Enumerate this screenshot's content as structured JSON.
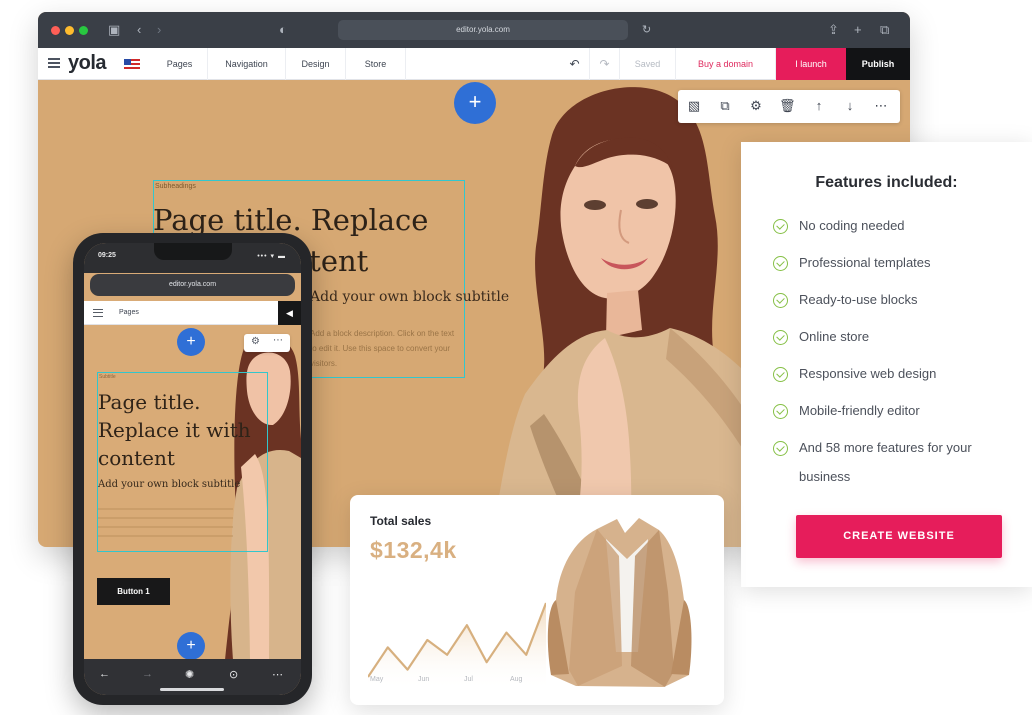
{
  "desktop": {
    "url": "editor.yola.com",
    "logo": "yola",
    "menu": [
      "Pages",
      "Navigation",
      "Design",
      "Store"
    ],
    "saved": "Saved",
    "buy_domain": "Buy a domain",
    "launch": "I launch",
    "publish": "Publish",
    "add_symbol": "+",
    "hero": {
      "kicker": "Subheadings",
      "title": "Page title. Replace it with content",
      "subtitle": "Add your own block subtitle",
      "description": "Add a block description. Click on the text to edit it. Use this space to convert your visitors."
    }
  },
  "features": {
    "title": "Features included:",
    "items": [
      "No coding needed",
      "Professional templates",
      "Ready-to-use blocks",
      "Online store",
      "Responsive web design",
      "Mobile-friendly editor",
      "And 58 more features for your business"
    ],
    "cta": "CREATE WEBSITE"
  },
  "sales": {
    "title": "Total sales",
    "value": "$132,4k",
    "months": [
      "May",
      "Jun",
      "Jul",
      "Aug"
    ]
  },
  "phone": {
    "time": "09:25",
    "signal": "••• ▾ ▬",
    "url": "editor.yola.com",
    "page_tab": "Pages",
    "publish_icon": "◀",
    "kicker": "Subtitle",
    "title": "Page title. Replace it with content",
    "subtitle": "Add your own block subtitle",
    "button": "Button 1",
    "add_symbol": "+"
  },
  "colors": {
    "accent": "#e61d5b",
    "hero_bg": "#d6a873",
    "add_button": "#2f6fd6",
    "check_green": "#86c046",
    "sales_value": "#d9b081",
    "selection": "#32c7ce"
  },
  "chart_data": {
    "type": "line",
    "x": [
      "May",
      "Jun",
      "Jul",
      "Aug"
    ],
    "title": "Total sales",
    "series": [
      {
        "values": [
          2,
          6,
          3,
          7,
          5,
          9,
          4,
          8,
          5,
          12
        ]
      }
    ]
  }
}
